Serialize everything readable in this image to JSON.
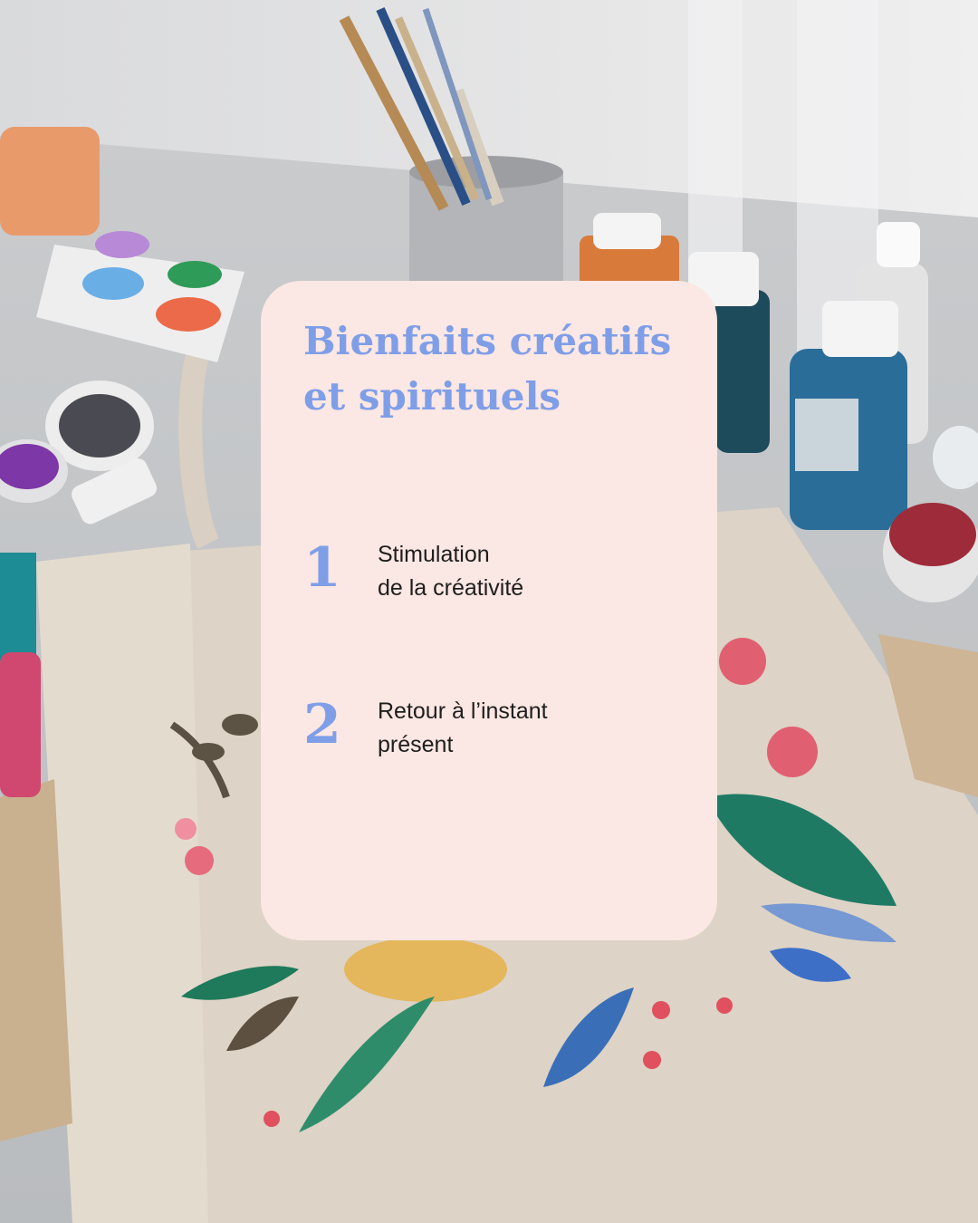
{
  "card": {
    "title_lines": [
      "Bienfaits créatifs",
      "et spirituels"
    ],
    "items": [
      {
        "number": "1",
        "lines": [
          "Stimulation",
          "de la créativité"
        ]
      },
      {
        "number": "2",
        "lines": [
          "Retour à l’instant",
          "présent"
        ]
      }
    ]
  },
  "colors": {
    "card_background": "#fbe7e3",
    "accent": "#7f9ee8",
    "text": "#1e1e1e"
  },
  "background_scene": {
    "icons": [
      "paint-brushes-icon",
      "paint-bottles-icon",
      "paint-palette-icon",
      "tote-bag-icon",
      "flower-painting-icon"
    ]
  }
}
